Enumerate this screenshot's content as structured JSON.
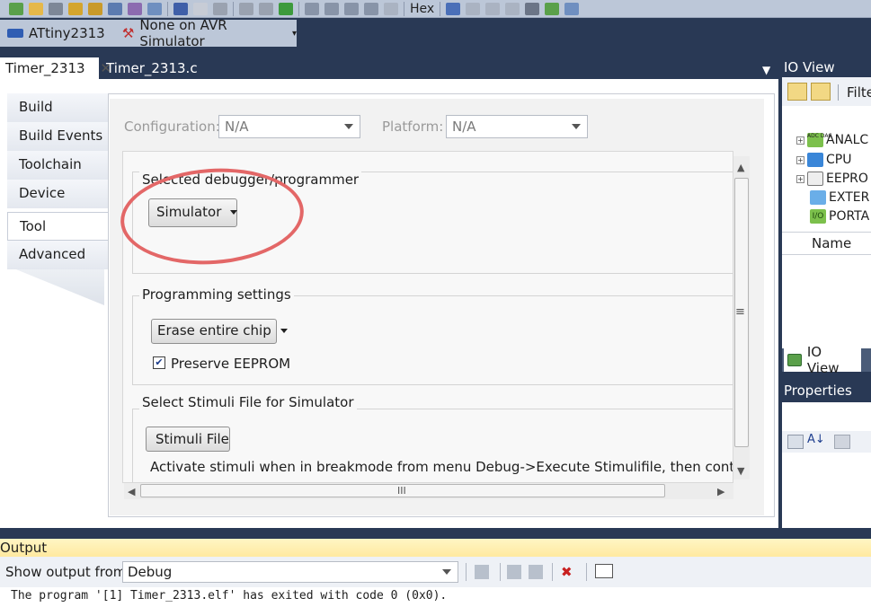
{
  "toolbar": {
    "hex_label": "Hex"
  },
  "device_bar": {
    "device": "ATtiny2313",
    "tool": "None on AVR Simulator"
  },
  "doc_tabs": [
    {
      "label": "Timer_2313",
      "active": true
    },
    {
      "label": "Timer_2313.c",
      "active": false
    }
  ],
  "side_tabs": [
    "Build",
    "Build Events",
    "Toolchain",
    "Device",
    "Tool",
    "Advanced"
  ],
  "selected_side_tab": "Tool",
  "config": {
    "configuration_label": "Configuration:",
    "configuration_value": "N/A",
    "platform_label": "Platform:",
    "platform_value": "N/A"
  },
  "debugger": {
    "title": "Selected debugger/programmer",
    "value": "Simulator"
  },
  "programming": {
    "title": "Programming settings",
    "erase_value": "Erase entire chip",
    "preserve_label": "Preserve EEPROM",
    "preserve_checked": true
  },
  "stimuli": {
    "title": "Select Stimuli File for Simulator",
    "button_label": "Stimuli File",
    "info": "Activate stimuli when in breakmode from menu Debug->Execute Stimulifile, then continue executi"
  },
  "hscroll_glyph": "III",
  "vscroll_glyph": "≡",
  "io_view": {
    "title": "IO View",
    "filter_label": "Filte",
    "tree": [
      {
        "label": "ANALC",
        "icon_text": "ADC DAC",
        "expandable": true
      },
      {
        "label": "CPU",
        "expandable": true
      },
      {
        "label": "EEPRO",
        "expandable": true
      },
      {
        "label": "EXTER",
        "expandable": false
      },
      {
        "label": "PORTA",
        "icon_text": "I/O",
        "expandable": false
      }
    ],
    "name_column": "Name",
    "tab_label": "IO View"
  },
  "properties": {
    "title": "Properties"
  },
  "output": {
    "title": "Output",
    "show_label": "Show output from:",
    "source": "Debug",
    "text": "The program '[1] Timer_2313.elf' has exited with code 0 (0x0)."
  },
  "colors": {
    "frame": "#293955",
    "annotation_circle": "#e36767",
    "output_header": "#ffe9a0"
  }
}
